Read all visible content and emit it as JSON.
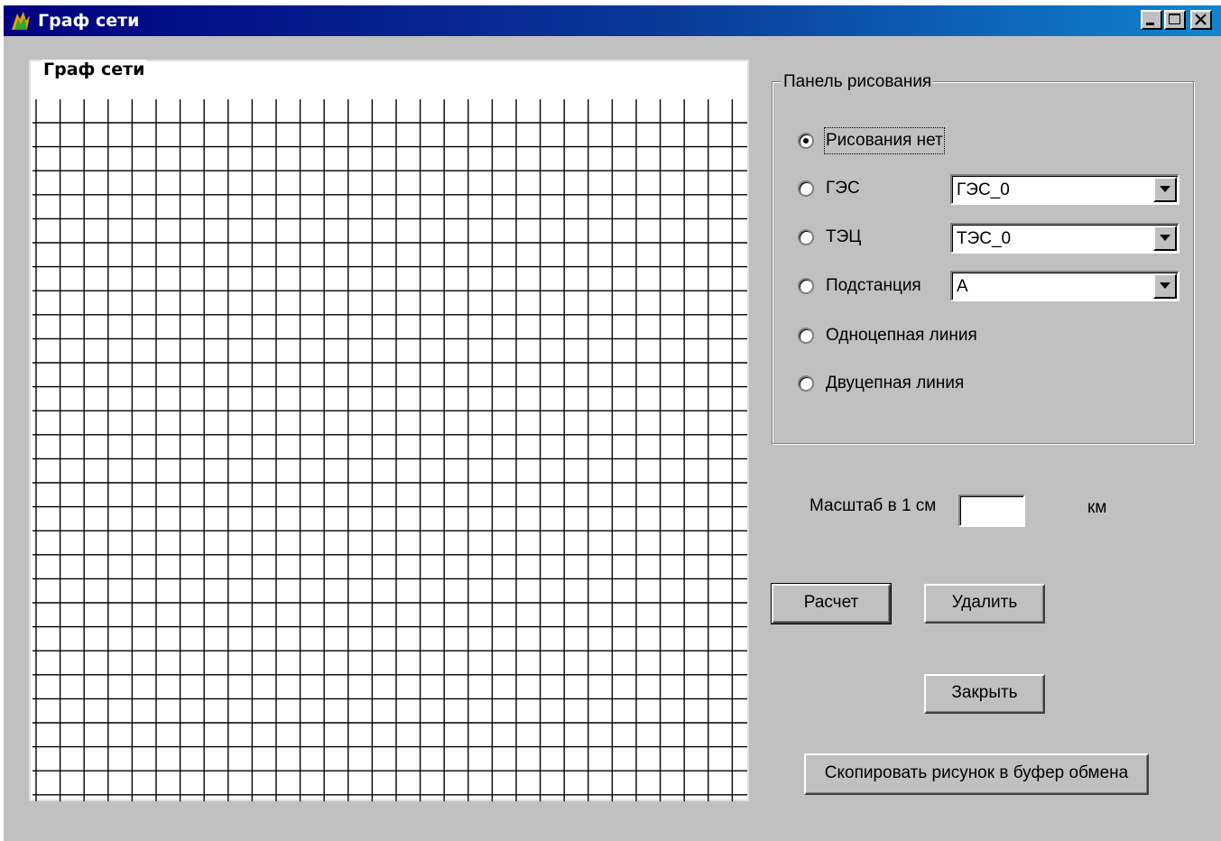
{
  "window": {
    "title": "Граф сети",
    "controls": {
      "minimize": "minimize-icon",
      "maximize": "maximize-icon",
      "close": "close-icon"
    }
  },
  "graph": {
    "group_label": "Граф сети"
  },
  "drawing_panel": {
    "label": "Панель рисования",
    "options": [
      {
        "label": "Рисования нет",
        "checked": true
      },
      {
        "label": "ГЭС",
        "checked": false
      },
      {
        "label": "ТЭЦ",
        "checked": false
      },
      {
        "label": "Подстанция",
        "checked": false
      },
      {
        "label": "Одноцепная линия",
        "checked": false
      },
      {
        "label": "Двуцепная линия",
        "checked": false
      }
    ],
    "combos": {
      "ges": "ГЭС_0",
      "tec": "ТЭС_0",
      "substation": "А"
    }
  },
  "scale": {
    "label": "Масштаб в 1 см",
    "value": "",
    "unit": "км"
  },
  "buttons": {
    "calculate": "Расчет",
    "delete": "Удалить",
    "close": "Закрыть",
    "copy": "Скопировать рисунок  в буфер обмена"
  }
}
